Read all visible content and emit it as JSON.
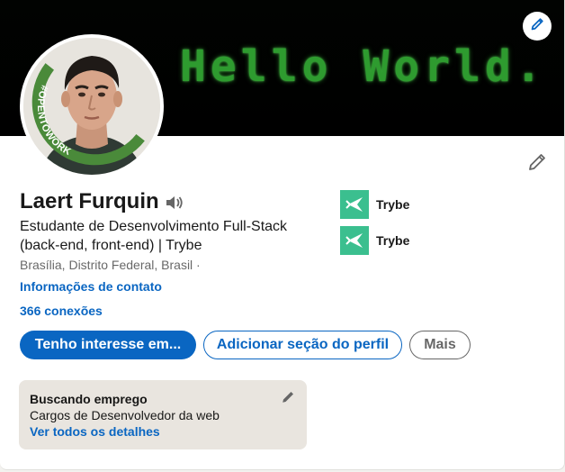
{
  "banner": {
    "text": "Hello World.",
    "edit_icon": "pencil-icon"
  },
  "profile": {
    "name": "Laert Furquin",
    "pronunciation_icon": "speaker-icon",
    "headline": "Estudante de Desenvolvimento Full-Stack (back-end, front-end) | Trybe",
    "location": "Brasília, Distrito Federal, Brasil",
    "location_sep": " ·",
    "contact_link": "Informações de contato",
    "connections": "366 conexões",
    "open_to_work_badge": "#OPENTOWORK"
  },
  "orgs": [
    {
      "name": "Trybe",
      "logo_icon": "trybe-logo-icon"
    },
    {
      "name": "Trybe",
      "logo_icon": "trybe-logo-icon"
    }
  ],
  "actions": {
    "primary": "Tenho interesse em...",
    "secondary": "Adicionar seção do perfil",
    "more": "Mais"
  },
  "open_to_work": {
    "title": "Buscando emprego",
    "description": "Cargos de Desenvolvedor da web",
    "link": "Ver todos os detalhes"
  },
  "colors": {
    "brand_blue": "#0a66c2",
    "open_to_work_green": "#4a8a3a",
    "trybe_green": "#3bbf8f",
    "banner_text_green": "#2e9b2f"
  }
}
